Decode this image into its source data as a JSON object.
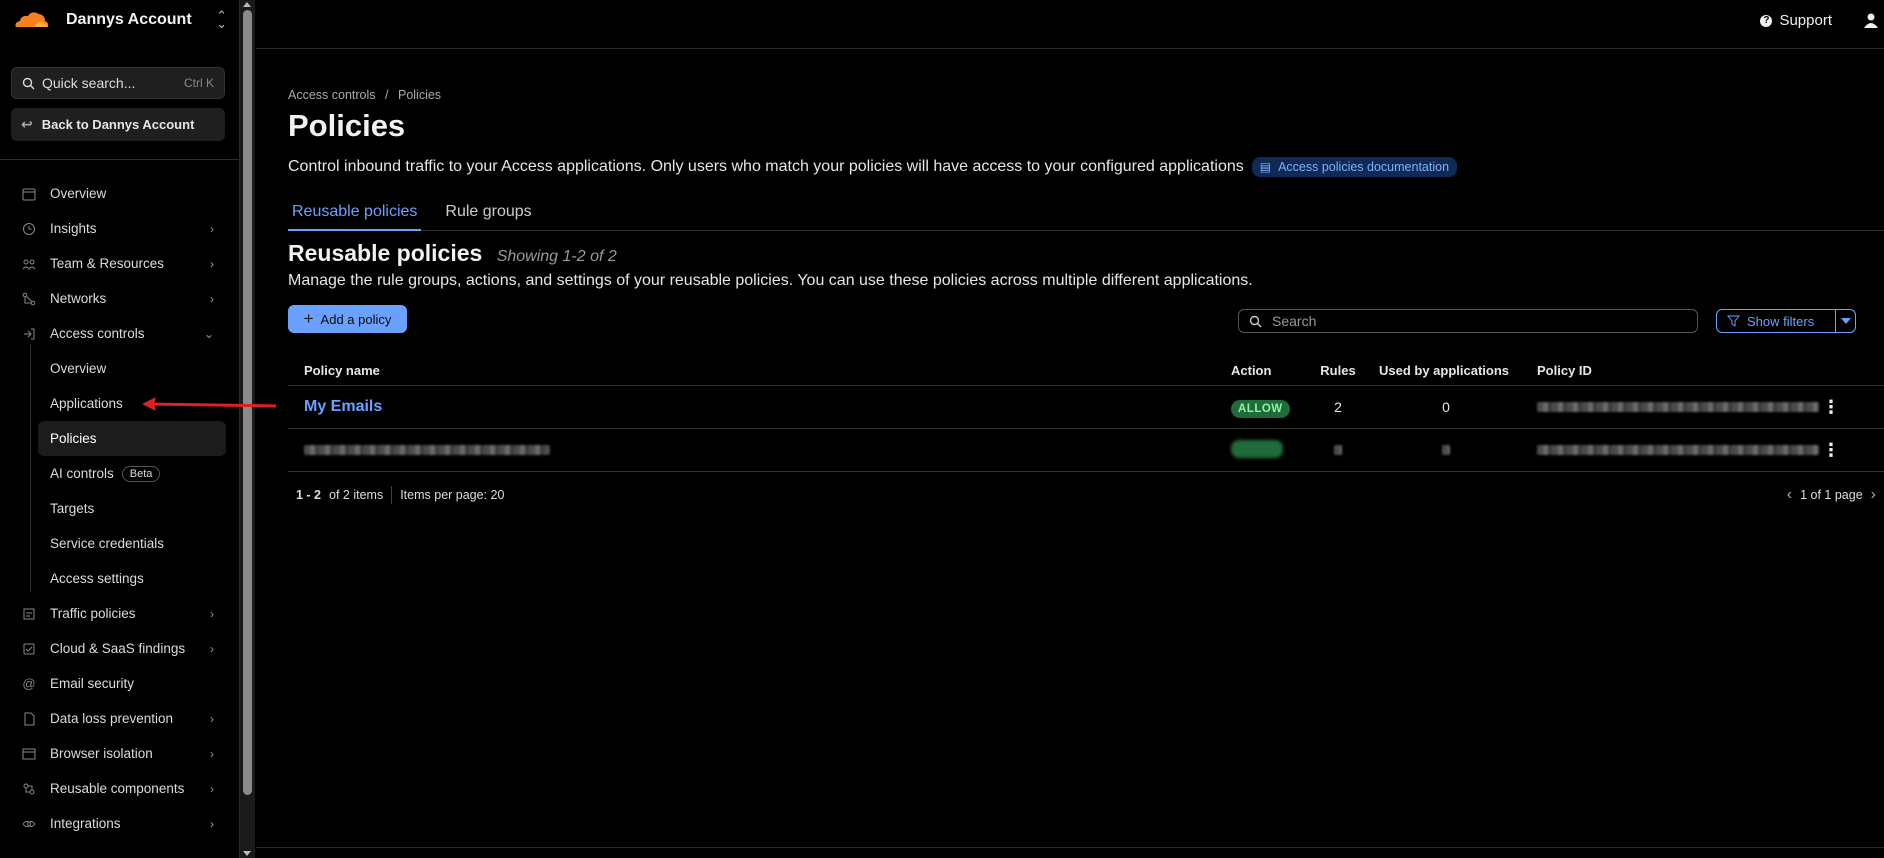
{
  "account": {
    "name": "Dannys Account"
  },
  "search": {
    "label": "Quick search...",
    "shortcut": "Ctrl K"
  },
  "back": {
    "label": "Back to Dannys Account"
  },
  "nav": {
    "overview": "Overview",
    "insights": "Insights",
    "team": "Team & Resources",
    "networks": "Networks",
    "access": "Access controls",
    "sub": {
      "overview": "Overview",
      "applications": "Applications",
      "policies": "Policies",
      "ai": "AI controls",
      "beta": "Beta",
      "targets": "Targets",
      "service": "Service credentials",
      "settings": "Access settings"
    },
    "traffic": "Traffic policies",
    "cloud": "Cloud & SaaS findings",
    "email": "Email security",
    "dlp": "Data loss prevention",
    "browser": "Browser isolation",
    "reusable": "Reusable components",
    "integrations": "Integrations"
  },
  "topbar": {
    "support": "Support"
  },
  "page": {
    "crumb_parent": "Access controls",
    "crumb_sep": "/",
    "crumb_current": "Policies",
    "title": "Policies",
    "description": "Control inbound traffic to your Access applications. Only users who match your policies will have access to your configured applications",
    "doc_link": "Access policies documentation",
    "tabs": [
      "Reusable policies",
      "Rule groups"
    ],
    "section_title": "Reusable policies",
    "showing": "Showing 1-2 of 2",
    "section_desc": "Manage the rule groups, actions, and settings of your reusable policies. You can use these policies across multiple different applications.",
    "add_button": "Add a policy",
    "search_placeholder": "Search",
    "filters": "Show filters"
  },
  "table": {
    "headers": [
      "Policy name",
      "Action",
      "Rules",
      "Used by applications",
      "Policy ID"
    ],
    "rows": [
      {
        "name": "My Emails",
        "action": "ALLOW",
        "rules": "2",
        "used": "0"
      }
    ]
  },
  "pager": {
    "range": "1 - 2",
    "total": "of 2 items",
    "per_page": "Items per page: 20",
    "page": "1 of 1 page"
  }
}
